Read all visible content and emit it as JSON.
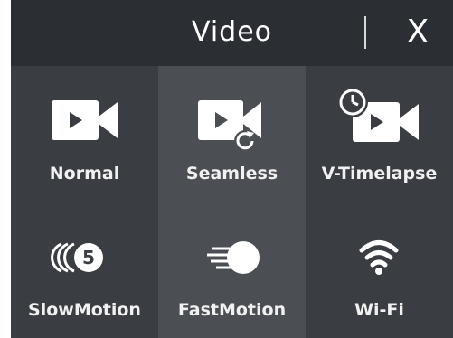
{
  "header": {
    "title": "Video",
    "close_label": "X"
  },
  "modes": [
    {
      "label": "Normal",
      "icon": "video-camera-icon"
    },
    {
      "label": "Seamless",
      "icon": "video-loop-icon"
    },
    {
      "label": "V-Timelapse",
      "icon": "timelapse-camera-icon"
    },
    {
      "label": "SlowMotion",
      "icon": "slow-motion-icon"
    },
    {
      "label": "FastMotion",
      "icon": "fast-motion-icon"
    },
    {
      "label": "Wi-Fi",
      "icon": "wifi-icon"
    }
  ],
  "colors": {
    "background": "#2a2d31",
    "tile": "#3a3d42",
    "tile_highlight": "#4b4e53",
    "icon": "#ffffff"
  }
}
